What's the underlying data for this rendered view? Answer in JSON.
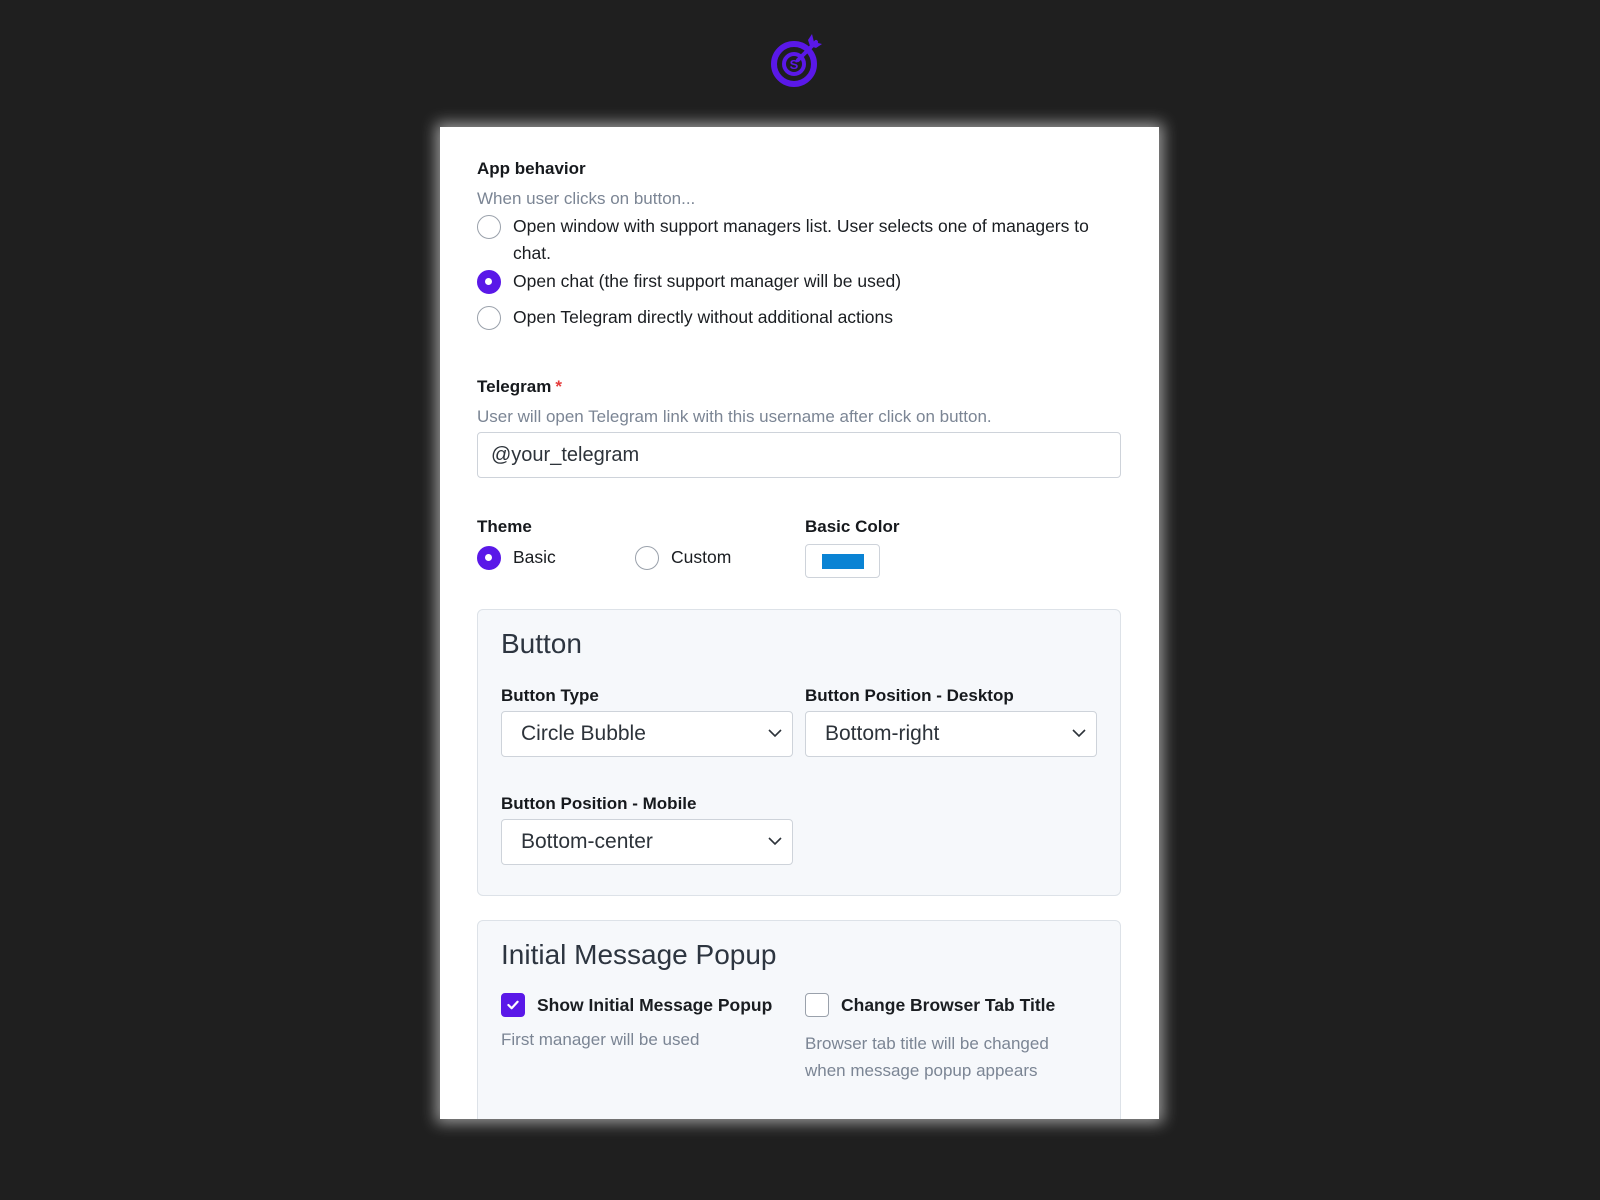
{
  "brand": {
    "logo_icon": "target-s-logo-icon",
    "accent": "#5a18e8"
  },
  "app_behavior": {
    "label": "App behavior",
    "hint": "When user clicks on button...",
    "options": [
      {
        "label_line1": "Open window with support managers list. User selects one of managers to",
        "label_line2": "chat.",
        "checked": false
      },
      {
        "label": "Open chat (the first support manager will be used)",
        "checked": true
      },
      {
        "label": "Open Telegram directly without additional actions",
        "checked": false
      }
    ]
  },
  "telegram": {
    "label": "Telegram",
    "required_mark": "*",
    "hint": "User will open Telegram link with this username after click on button.",
    "value": "@your_telegram"
  },
  "theme": {
    "label": "Theme",
    "options": [
      {
        "label": "Basic",
        "checked": true
      },
      {
        "label": "Custom",
        "checked": false
      }
    ]
  },
  "basic_color": {
    "label": "Basic Color",
    "value": "#0a83d4"
  },
  "button_section": {
    "title": "Button",
    "type_label": "Button Type",
    "type_value": "Circle Bubble",
    "desktop_label": "Button Position - Desktop",
    "desktop_value": "Bottom-right",
    "mobile_label": "Button Position - Mobile",
    "mobile_value": "Bottom-center"
  },
  "popup_section": {
    "title": "Initial Message Popup",
    "show_popup_label": "Show Initial Message Popup",
    "show_popup_checked": true,
    "show_popup_hint": "First manager will be used",
    "tab_title_label": "Change Browser Tab Title",
    "tab_title_checked": false,
    "tab_title_hint_line1": "Browser tab title will be changed",
    "tab_title_hint_line2": "when message popup appears"
  }
}
